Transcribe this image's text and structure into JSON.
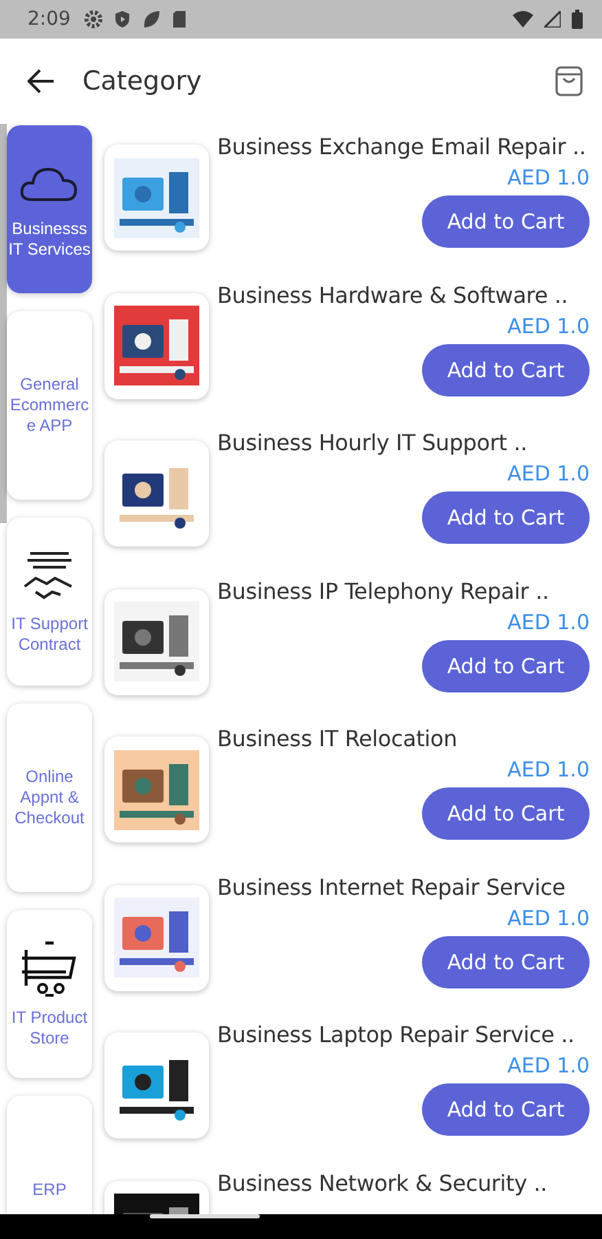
{
  "status_bar": {
    "time": "2:09"
  },
  "app_bar": {
    "title": "Category"
  },
  "categories": [
    {
      "label": "Businesss IT Services",
      "kind": "icon",
      "selected": true
    },
    {
      "label": "General Ecommerce APP",
      "kind": "text",
      "selected": false
    },
    {
      "label": "IT Support Contract",
      "kind": "icon",
      "selected": false
    },
    {
      "label": "Online Appnt & Checkout",
      "kind": "text",
      "selected": false
    },
    {
      "label": "IT Product Store",
      "kind": "icon",
      "selected": false
    },
    {
      "label": "ERP",
      "kind": "text",
      "selected": false
    }
  ],
  "products": [
    {
      "title": "Business Exchange Email Repair ..",
      "price": "AED 1.0",
      "button": "Add to Cart"
    },
    {
      "title": "Business Hardware & Software ..",
      "price": "AED 1.0",
      "button": "Add to Cart"
    },
    {
      "title": "Business Hourly IT Support ..",
      "price": "AED 1.0",
      "button": "Add to Cart"
    },
    {
      "title": "Business IP Telephony Repair ..",
      "price": "AED 1.0",
      "button": "Add to Cart"
    },
    {
      "title": "Business IT Relocation",
      "price": "AED 1.0",
      "button": "Add to Cart"
    },
    {
      "title": "Business Internet Repair Service",
      "price": "AED 1.0",
      "button": "Add to Cart"
    },
    {
      "title": "Business Laptop Repair Service ..",
      "price": "AED 1.0",
      "button": "Add to Cart"
    },
    {
      "title": "Business Network & Security .."
    }
  ]
}
